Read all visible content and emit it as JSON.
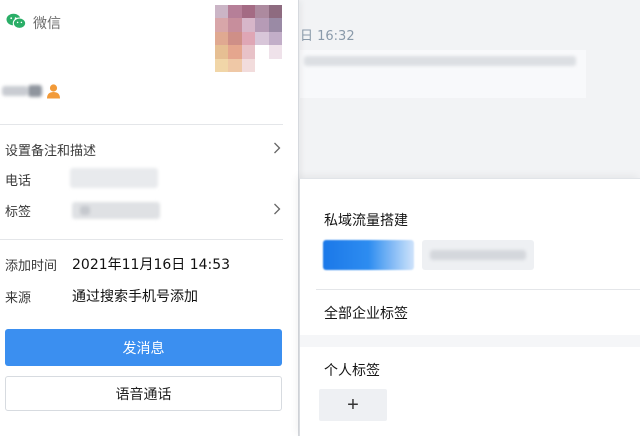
{
  "chat": {
    "time": "日 16:32"
  },
  "card": {
    "app_name": "微信",
    "logo_icon": "wechat-logo-icon",
    "user_icon": "person-icon",
    "avatar_colors": [
      "#cbb5c6",
      "#b67f98",
      "#a46b84",
      "#ad8a9f",
      "#8e6b80",
      "#d8a6a9",
      "#c78e9c",
      "#d7b6c9",
      "#b69bb6",
      "#9a8aa5",
      "#e0a991",
      "#cf8f87",
      "#dfa6b5",
      "#d8c6d9",
      "#c2aec8",
      "#e6bf93",
      "#e5a68e",
      "#e8c2c8",
      "#ffffff",
      "#efe2ea",
      "#f1d6a8",
      "#efc8a6",
      "#f2dcdc",
      "#ffffff",
      "#ffffff"
    ],
    "settings_label": "设置备注和描述",
    "phone_label": "电话",
    "tags_label": "标签",
    "added_time_label": "添加时间",
    "added_time_value": "2021年11月16日 14:53",
    "source_label": "来源",
    "source_value": "通过搜索手机号添加",
    "send_button": "发消息",
    "voice_button": "语音通话",
    "colors": {
      "primary": "#3b8ff0",
      "divider": "#e4e6e9"
    }
  },
  "popup": {
    "group_title": "私域流量搭建",
    "all_tags_label": "全部企业标签",
    "personal_tags_label": "个人标签",
    "add_icon": "plus-icon",
    "add_button": "+",
    "colors": {
      "selected_tag": "#2d8cf0"
    }
  }
}
